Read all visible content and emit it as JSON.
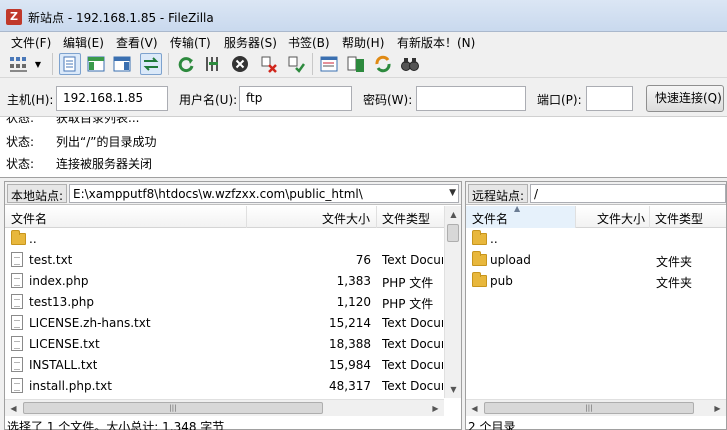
{
  "window": {
    "title": "新站点 - 192.168.1.85 - FileZilla",
    "logo": "Z"
  },
  "menu": [
    "文件(F)",
    "编辑(E)",
    "查看(V)",
    "传输(T)",
    "服务器(S)",
    "书签(B)",
    "帮助(H)",
    "有新版本！(N)"
  ],
  "toolbar_icons": [
    "site-manager-icon",
    "dropdown-arrow-icon",
    "toggle-log-icon",
    "toggle-local-tree-icon",
    "toggle-remote-tree-icon",
    "toggle-queue-icon",
    "refresh-icon",
    "process-queue-icon",
    "cancel-icon",
    "disconnect-icon",
    "reconnect-icon",
    "filter-icon",
    "compare-icon",
    "sync-browse-icon",
    "search-icon"
  ],
  "quickconnect": {
    "host_label": "主机(H):",
    "host_value": "192.168.1.85",
    "user_label": "用户名(U):",
    "user_value": "ftp",
    "pass_label": "密码(W):",
    "pass_value": "",
    "port_label": "端口(P):",
    "port_value": "",
    "button_label": "快速连接(Q)"
  },
  "log": [
    {
      "key": "状态:",
      "value": "获取目录列表..."
    },
    {
      "key": "状态:",
      "value": "列出“/”的目录成功"
    },
    {
      "key": "状态:",
      "value": "连接被服务器关闭"
    }
  ],
  "local": {
    "site_label": "本地站点:",
    "path": "E:\\xampputf8\\htdocs\\w.wzfzxx.com\\public_html\\",
    "columns": {
      "name": "文件名",
      "size": "文件大小",
      "type": "文件类型"
    },
    "files": [
      {
        "name": "..",
        "size": "",
        "type": "",
        "kind": "folder"
      },
      {
        "name": "test.txt",
        "size": "76",
        "type": "Text Document",
        "kind": "file"
      },
      {
        "name": "index.php",
        "size": "1,383",
        "type": "PHP 文件",
        "kind": "file"
      },
      {
        "name": "test13.php",
        "size": "1,120",
        "type": "PHP 文件",
        "kind": "file"
      },
      {
        "name": "LICENSE.zh-hans.txt",
        "size": "15,214",
        "type": "Text Document",
        "kind": "file"
      },
      {
        "name": "LICENSE.txt",
        "size": "18,388",
        "type": "Text Document",
        "kind": "file"
      },
      {
        "name": "INSTALL.txt",
        "size": "15,984",
        "type": "Text Document",
        "kind": "file"
      },
      {
        "name": "install.php.txt",
        "size": "48,317",
        "type": "Text Document",
        "kind": "file"
      }
    ],
    "status": "选择了 1 个文件。大小总计: 1,348 字节"
  },
  "remote": {
    "site_label": "远程站点:",
    "path": "/",
    "columns": {
      "name": "文件名",
      "size": "文件大小",
      "type": "文件类型"
    },
    "files": [
      {
        "name": "..",
        "size": "",
        "type": "",
        "kind": "folder"
      },
      {
        "name": "upload",
        "size": "",
        "type": "文件夹",
        "kind": "folder"
      },
      {
        "name": "pub",
        "size": "",
        "type": "文件夹",
        "kind": "folder"
      }
    ],
    "status": "2 个目录"
  },
  "colors": {
    "accent": "#3a7bd5",
    "folder": "#e8b73c",
    "titlebar": "#dbe6f4"
  }
}
